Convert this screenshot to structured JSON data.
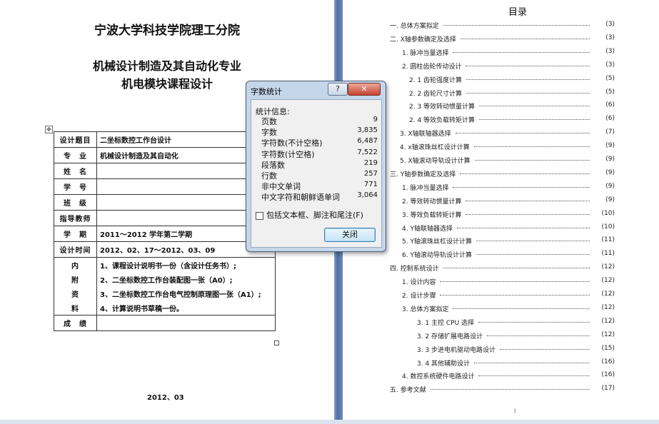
{
  "left_page": {
    "school_title": "宁波大学科技学院理工分院",
    "major_title": "机械设计制造及其自动化专业",
    "course_title": "机电模块课程设计",
    "table_anchor_icon": "move-anchor-icon",
    "table": {
      "rows": [
        {
          "label": "设计题目",
          "value": "二坐标数控工作台设计"
        },
        {
          "label": "专　业",
          "value": "机械设计制造及其自动化"
        },
        {
          "label": "姓　名",
          "value": ""
        },
        {
          "label": "学　号",
          "value": ""
        },
        {
          "label": "班　级",
          "value": ""
        },
        {
          "label": "指导教师",
          "value": ""
        },
        {
          "label": "学　期",
          "value": "2011～2012 学年第二学期"
        },
        {
          "label": "设计时间",
          "value": "2012、02、17～2012、03、09"
        }
      ],
      "contents_labels": [
        "内",
        "附",
        "资",
        "料"
      ],
      "contents_items": [
        "1、课程设计说明书一份（含设计任务书）;",
        "2、二坐标数控工作台装配图一张（A0）;",
        "3、二坐标数控工作台电气控制原理图一张（A1）;",
        "4、计算说明书草稿一份。"
      ],
      "grade_label": "成　绩",
      "grade_value": ""
    },
    "date": "2012、03"
  },
  "toc": {
    "title": "目录",
    "entries": [
      {
        "label": "一. 总体方案拟定",
        "page": "(3)"
      },
      {
        "label": "二. X轴参数确定及选择",
        "page": "(3)"
      },
      {
        "label": "1. 脉冲当量选择",
        "page": "(3)"
      },
      {
        "label": "2. 圆柱齿轮传动设计",
        "page": "(3)"
      },
      {
        "label": "2. 1 齿轮强度计算",
        "page": "(5)"
      },
      {
        "label": "2. 2 齿轮尺寸计算",
        "page": "(5)"
      },
      {
        "label": "2. 3 等效转动惯量计算",
        "page": "(6)"
      },
      {
        "label": "2. 4 等效负载转矩计算",
        "page": "(6)"
      },
      {
        "label": "3. X轴联轴器选择",
        "page": "(7)"
      },
      {
        "label": "4. x轴滚珠丝杠设计计算",
        "page": "(9)"
      },
      {
        "label": "5. X轴滚动导轨设计计算",
        "page": "(9)"
      },
      {
        "label": "三. Y轴参数确定及选择",
        "page": "(9)"
      },
      {
        "label": "1. 脉冲当量选择",
        "page": "(9)"
      },
      {
        "label": "2. 等效转动惯量计算",
        "page": "(9)"
      },
      {
        "label": "3. 等效负载转矩计算",
        "page": "(10)"
      },
      {
        "label": "4. Y轴联轴器选择",
        "page": "(10)"
      },
      {
        "label": "5. Y轴滚珠丝杠设计计算",
        "page": "(11)"
      },
      {
        "label": "6. Y轴滚动导轨设计计算",
        "page": "(11)"
      },
      {
        "label": "四. 控制系统设计",
        "page": "(12)"
      },
      {
        "label": "1. 设计内容",
        "page": "(12)"
      },
      {
        "label": "2. 设计步骤",
        "page": "(12)"
      },
      {
        "label": "3. 总体方案拟定",
        "page": "(12)"
      },
      {
        "label": "3. 1 主控 CPU 选择",
        "page": "(12)"
      },
      {
        "label": "3. 2 存储扩展电路设计",
        "page": "(12)"
      },
      {
        "label": "3. 3 步进电机驱动电路设计",
        "page": "(15)"
      },
      {
        "label": "3. 4 其他辅助设计",
        "page": "(16)"
      },
      {
        "label": "4. 数控系统硬件电路设计",
        "page": "(16)"
      },
      {
        "label": "五. 参考文献",
        "page": "(17)"
      }
    ],
    "footer_mark": "1"
  },
  "dialog": {
    "title": "字数统计",
    "help_label": "?",
    "close_label": "✕",
    "stats_heading": "统计信息:",
    "stats": [
      {
        "name": "页数",
        "value": "9"
      },
      {
        "name": "字数",
        "value": "3,835"
      },
      {
        "name": "字符数(不计空格)",
        "value": "6,487"
      },
      {
        "name": "字符数(计空格)",
        "value": "7,522"
      },
      {
        "name": "段落数",
        "value": "219"
      },
      {
        "name": "行数",
        "value": "257"
      },
      {
        "name": "非中文单词",
        "value": "771"
      },
      {
        "name": "中文字符和朝鲜语单词",
        "value": "3,064"
      }
    ],
    "checkbox_label": "包括文本框、脚注和尾注(F)",
    "checkbox_checked": false,
    "ok_label": "关闭"
  }
}
